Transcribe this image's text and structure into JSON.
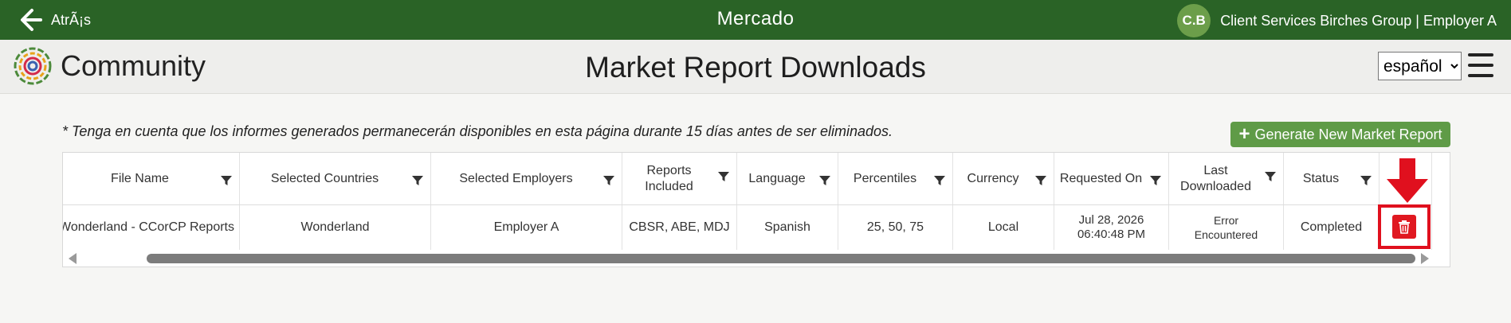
{
  "topbar": {
    "back_label": "AtrÃ¡s",
    "app_title": "Mercado",
    "user_initials": "C.B",
    "user_name": "Client Services Birches Group | Employer A"
  },
  "subheader": {
    "brand": "Community",
    "page_title": "Market Report Downloads",
    "language_selected": "español"
  },
  "note": "* Tenga en cuenta que los informes generados permanecerán disponibles en esta página durante 15 días antes de ser eliminados.",
  "generate_button": {
    "label": "Generate New Market Report"
  },
  "table": {
    "columns": [
      {
        "label": "File Name"
      },
      {
        "label": "Selected Countries"
      },
      {
        "label": "Selected Employers"
      },
      {
        "label": "Reports\nIncluded"
      },
      {
        "label": "Language"
      },
      {
        "label": "Percentiles"
      },
      {
        "label": "Currency"
      },
      {
        "label": "Requested On"
      },
      {
        "label": "Last\nDownloaded"
      },
      {
        "label": "Status"
      }
    ],
    "rows": [
      {
        "file_name": "Wonderland - CCorCP Reports",
        "countries": "Wonderland",
        "employers": "Employer A",
        "reports": "CBSR, ABE, MDJ",
        "language": "Spanish",
        "percentiles": "25, 50, 75",
        "currency": "Local",
        "requested_on": "Jul 28, 2026\n06:40:48 PM",
        "last_downloaded": "Error\nEncountered",
        "status": "Completed"
      }
    ]
  },
  "colors": {
    "topbar": "#2a6326",
    "accent_button": "#5f9b47",
    "delete": "#e01820",
    "highlight": "#e0101e"
  },
  "icons": [
    "back-arrow-icon",
    "community-logo-icon",
    "hamburger-menu-icon",
    "filter-icon",
    "trash-icon",
    "red-down-arrow-icon"
  ]
}
